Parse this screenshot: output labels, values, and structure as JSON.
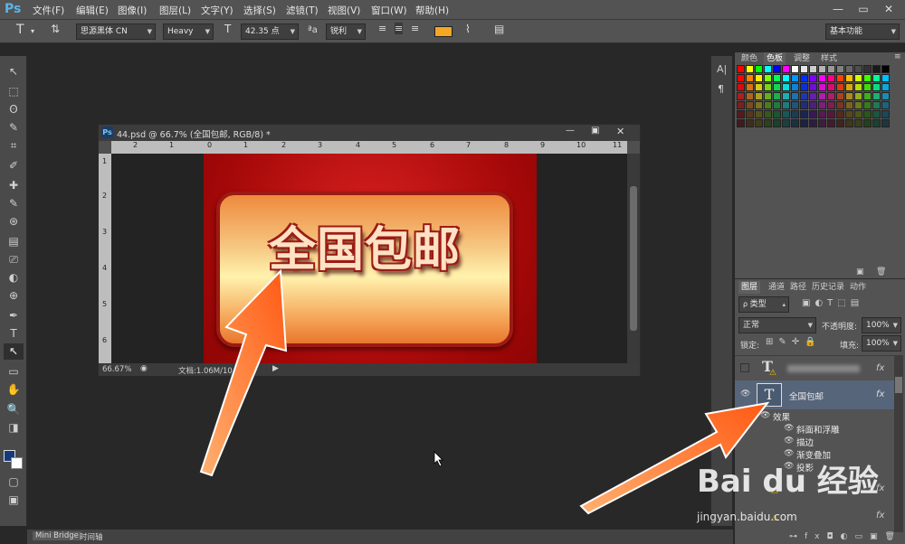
{
  "app": {
    "logo": "Ps"
  },
  "menu": [
    "文件(F)",
    "编辑(E)",
    "图像(I)",
    "图层(L)",
    "文字(Y)",
    "选择(S)",
    "滤镜(T)",
    "视图(V)",
    "窗口(W)",
    "帮助(H)"
  ],
  "window_controls": [
    "—",
    "▭",
    "✕"
  ],
  "options": {
    "tool_glyph": "T",
    "font_family": "思源黑体 CN",
    "font_style": "Heavy",
    "font_size": "42.35 点",
    "aa_label": "ªa",
    "antialias": "锐利",
    "workspace": "基本功能",
    "text_color": "#f5a623"
  },
  "tools": [
    "↖",
    "⬚",
    "ʘ",
    "✎",
    "⌗",
    "✐",
    "✚",
    "✎",
    "⊛",
    "▤",
    "⎚",
    "◐",
    "⊕",
    "✒",
    "T",
    "↖",
    "▭",
    "✋",
    "🔍",
    "◨",
    "▢",
    "▣"
  ],
  "document": {
    "title": "44.psd @ 66.7% (全国包邮, RGB/8) *",
    "zoom": "66.67%",
    "doc_info": "文档:1.06M/10",
    "hruler_ticks": [
      "2",
      "1",
      "0",
      "1",
      "2",
      "3",
      "4",
      "5",
      "6",
      "7",
      "8",
      "9",
      "10",
      "11"
    ],
    "vruler_ticks": [
      "1",
      "2",
      "3",
      "4",
      "5",
      "6"
    ],
    "banner_text": "全国包邮"
  },
  "swatch_panel": {
    "tabs": [
      "颜色",
      "色板",
      "调整",
      "样式"
    ],
    "active_tab": "色板"
  },
  "layers_panel": {
    "tabs": [
      "图层",
      "通道",
      "路径",
      "历史记录",
      "动作"
    ],
    "filter": "类型",
    "blend_mode": "正常",
    "opacity_label": "不透明度:",
    "opacity": "100%",
    "lock_label": "锁定:",
    "fill_label": "填充:",
    "fill": "100%",
    "layers": [
      {
        "name": "",
        "selected": false
      },
      {
        "name": "全国包邮",
        "selected": true
      }
    ],
    "effects_label": "效果",
    "effects": [
      "斜面和浮雕",
      "描边",
      "渐变叠加",
      "投影"
    ],
    "fx_label": "fx"
  },
  "bottom_tabs": [
    "Mini Bridge",
    "时间轴"
  ],
  "watermark": {
    "brand": "Bai du 经验",
    "url": "jingyan.baidu.com"
  }
}
